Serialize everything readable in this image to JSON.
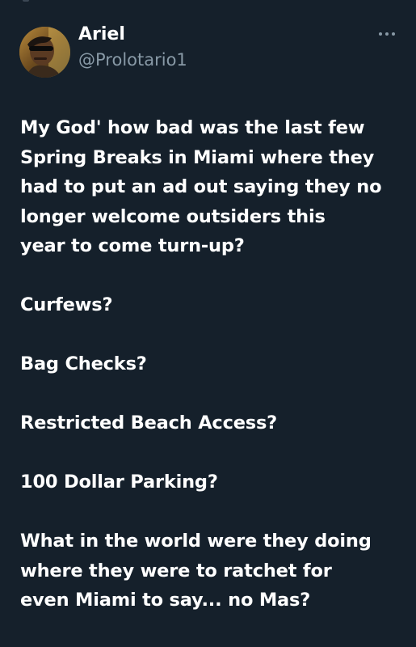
{
  "tweet": {
    "author": {
      "display_name": "Ariel",
      "handle": "@Prolotario1",
      "avatar_icon": "user-avatar-photo"
    },
    "more_icon": "more-horizontal-icon",
    "text": "My God' how bad was the last few\nSpring Breaks in Miami where they\nhad to put an ad out saying they no\nlonger welcome outsiders this\nyear to come turn-up?\n\nCurfews?\n\nBag Checks?\n\nRestricted Beach Access?\n\n100 Dollar Parking?\n\nWhat in the world were they doing\nwhere they were to ratchet for\neven Miami to say... no Mas?"
  },
  "colors": {
    "background": "#15202b",
    "text": "#ffffff",
    "secondary_text": "#8899a6"
  }
}
